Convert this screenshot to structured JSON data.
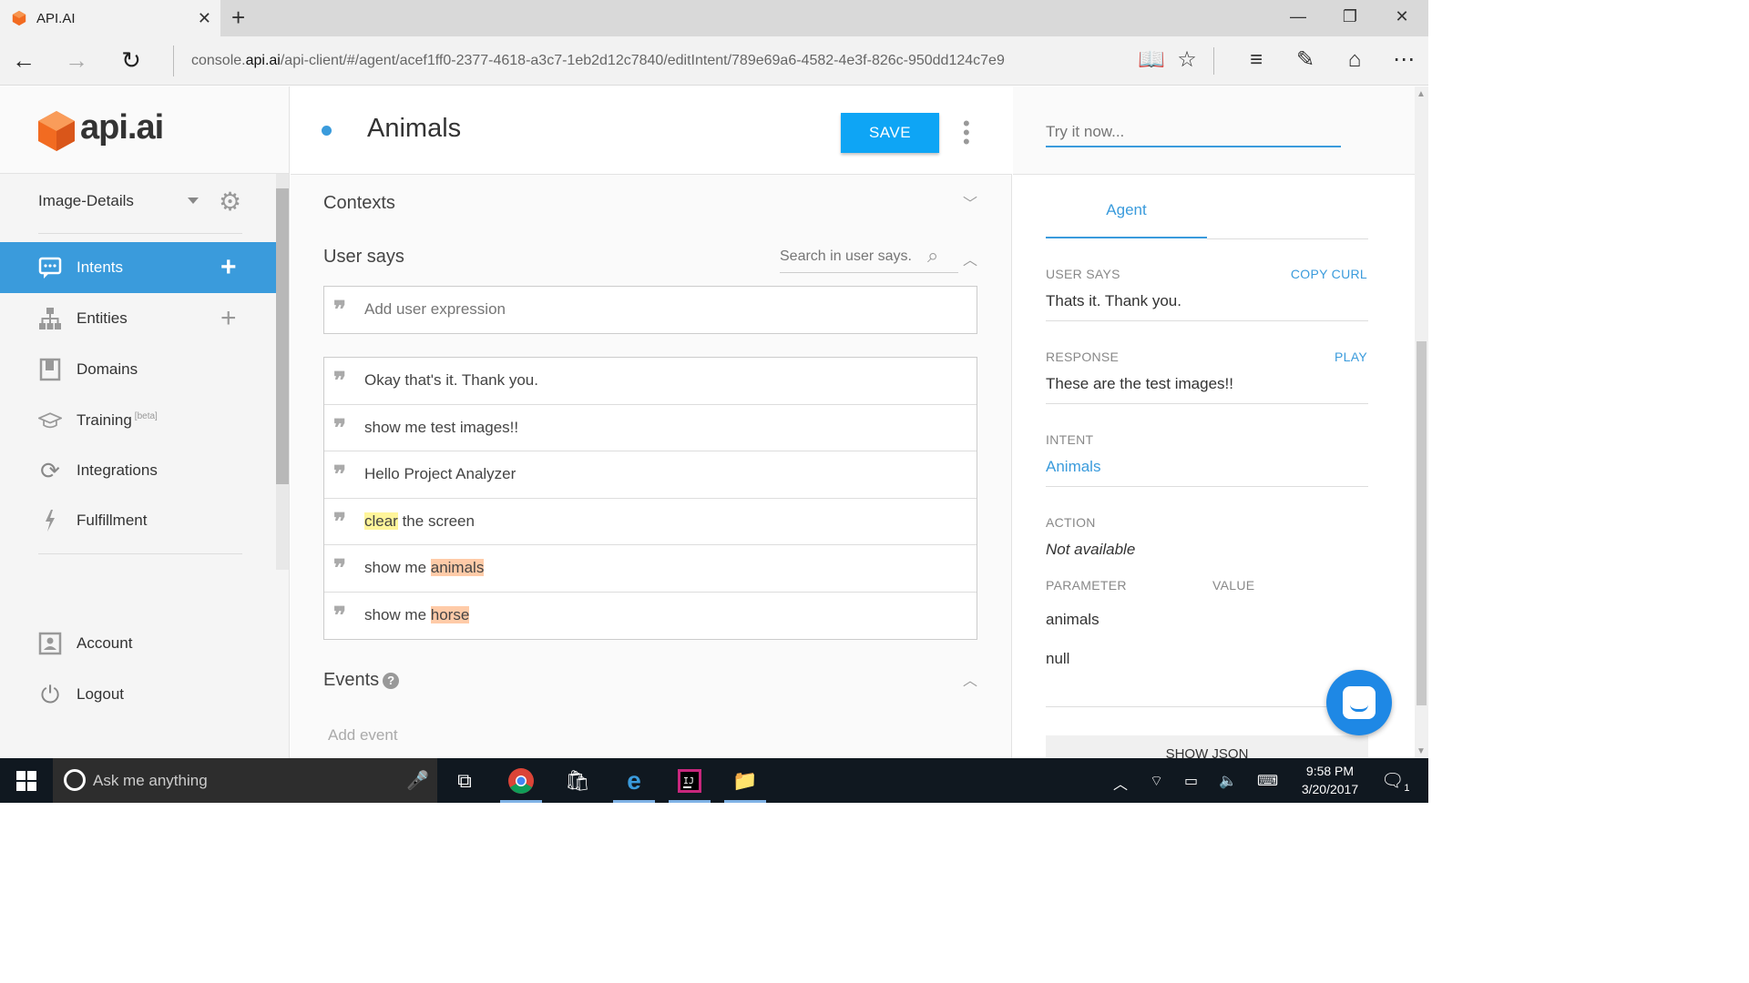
{
  "browser": {
    "tab_title": "API.AI",
    "url_prefix": "console.",
    "url_domain": "api.ai",
    "url_rest": "/api-client/#/agent/acef1ff0-2377-4618-a3c7-1eb2d12c7840/editIntent/789e69a6-4582-4e3f-826c-950dd124c7e9"
  },
  "sidebar": {
    "logo_text": "api.ai",
    "agent_name": "Image-Details",
    "items": [
      {
        "label": "Intents",
        "icon": "chat-icon",
        "active": true,
        "plus": true
      },
      {
        "label": "Entities",
        "icon": "sitemap-icon",
        "active": false,
        "plus": true
      },
      {
        "label": "Domains",
        "icon": "book-icon",
        "active": false,
        "plus": false
      },
      {
        "label": "Training",
        "icon": "graduation-cap-icon",
        "active": false,
        "plus": false,
        "badge": "[beta]"
      },
      {
        "label": "Integrations",
        "icon": "refresh-icon",
        "active": false,
        "plus": false
      },
      {
        "label": "Fulfillment",
        "icon": "lightning-icon",
        "active": false,
        "plus": false
      }
    ],
    "account_label": "Account",
    "logout_label": "Logout"
  },
  "intent": {
    "title": "Animals",
    "save_label": "SAVE"
  },
  "sections": {
    "contexts": "Contexts",
    "user_says": "User says",
    "search_placeholder": "Search in user says.",
    "add_expression_placeholder": "Add user expression",
    "events": "Events",
    "add_event_placeholder": "Add event"
  },
  "expressions": [
    {
      "pre": "Okay that's it. Thank you.",
      "hl": "",
      "hl_type": "",
      "post": ""
    },
    {
      "pre": "show me test images!!",
      "hl": "",
      "hl_type": "",
      "post": ""
    },
    {
      "pre": "Hello Project Analyzer",
      "hl": "",
      "hl_type": "",
      "post": ""
    },
    {
      "pre": "",
      "hl": "clear",
      "hl_type": "yellow",
      "post": " the screen"
    },
    {
      "pre": "show me ",
      "hl": "animals",
      "hl_type": "orange",
      "post": ""
    },
    {
      "pre": "show me ",
      "hl": "horse",
      "hl_type": "orange",
      "post": ""
    }
  ],
  "right": {
    "try_placeholder": "Try it now...",
    "tab": "Agent",
    "user_says_label": "USER SAYS",
    "copy_curl": "COPY CURL",
    "user_says_value": "Thats it. Thank you.",
    "response_label": "RESPONSE",
    "play": "PLAY",
    "response_value": "These are the test images!!",
    "intent_label": "INTENT",
    "intent_value": "Animals",
    "action_label": "ACTION",
    "action_value": "Not available",
    "parameter_label": "PARAMETER",
    "value_label": "VALUE",
    "param_name": "animals",
    "param_value": "null",
    "show_json": "SHOW JSON"
  },
  "taskbar": {
    "search_placeholder": "Ask me anything",
    "time": "9:58 PM",
    "date": "3/20/2017",
    "notif_count": "1"
  },
  "colors": {
    "accent": "#3a9bdc",
    "save_button": "#0ea5f5",
    "highlight_yellow": "#fff59a",
    "highlight_orange": "#ffcba8",
    "logo_orange": "#f26b21"
  }
}
